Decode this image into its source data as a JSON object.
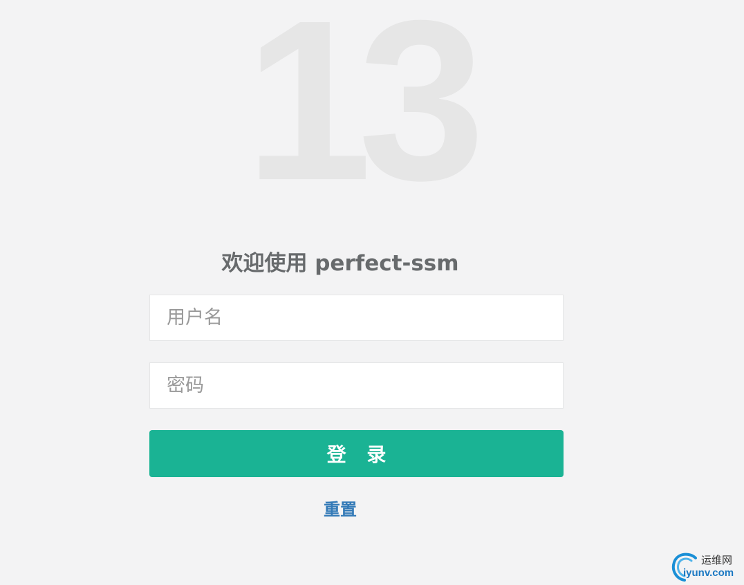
{
  "logo": {
    "text": "13"
  },
  "welcome": {
    "title": "欢迎使用 perfect-ssm"
  },
  "form": {
    "username": {
      "placeholder": "用户名",
      "value": ""
    },
    "password": {
      "placeholder": "密码",
      "value": ""
    },
    "login_label": "登 录",
    "reset_label": "重置"
  },
  "colors": {
    "background": "#f3f3f4",
    "primary": "#1ab394",
    "link": "#337ab7",
    "logo": "#e6e6e6"
  },
  "watermark": {
    "icon": "swirl-logo-icon",
    "cn_text": "运维网",
    "en_text": "iyunv.com"
  }
}
